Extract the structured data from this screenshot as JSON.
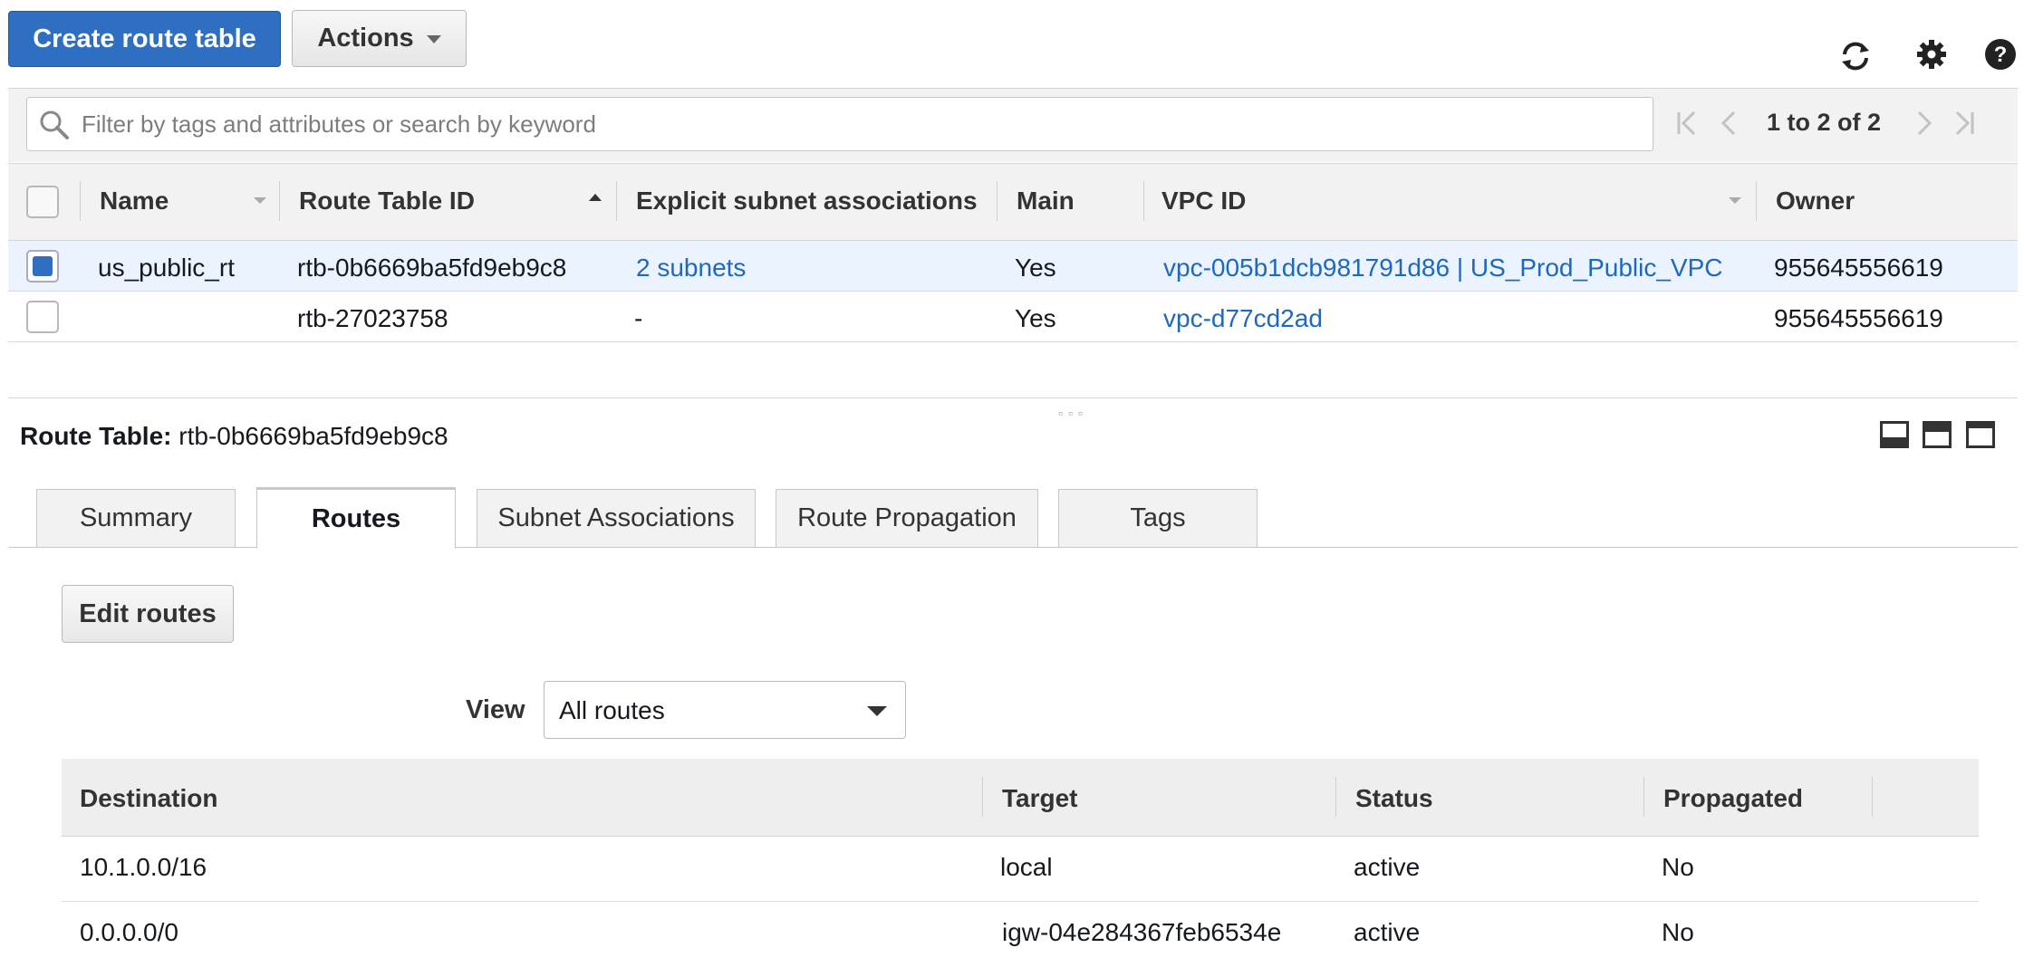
{
  "toolbar": {
    "create_label": "Create route table",
    "actions_label": "Actions"
  },
  "icons": {
    "refresh": "refresh-icon",
    "settings": "gear-icon",
    "help": "help-icon"
  },
  "colors": {
    "primary": "#2f6fc1",
    "link": "#1e68bf",
    "selected_row": "#eaf3fe"
  },
  "filter": {
    "placeholder": "Filter by tags and attributes or search by keyword",
    "value": ""
  },
  "pagination": {
    "text": "1 to 2 of 2"
  },
  "table": {
    "columns": [
      "Name",
      "Route Table ID",
      "Explicit subnet associations",
      "Main",
      "VPC ID",
      "Owner"
    ],
    "rows": [
      {
        "selected": true,
        "name": "us_public_rt",
        "route_table_id": "rtb-0b6669ba5fd9eb9c8",
        "subnets": "2 subnets",
        "main": "Yes",
        "vpc_id": "vpc-005b1dcb981791d86 | US_Prod_Public_VPC",
        "owner": "955645556619"
      },
      {
        "selected": false,
        "name": "",
        "route_table_id": "rtb-27023758",
        "subnets": "-",
        "main": "Yes",
        "vpc_id": "vpc-d77cd2ad",
        "owner": "955645556619"
      }
    ]
  },
  "detail": {
    "label": "Route Table:",
    "value": "rtb-0b6669ba5fd9eb9c8",
    "tabs": [
      "Summary",
      "Routes",
      "Subnet Associations",
      "Route Propagation",
      "Tags"
    ],
    "active_tab": "Routes",
    "edit_label": "Edit routes",
    "view_label": "View",
    "view_selected": "All routes",
    "routes_columns": [
      "Destination",
      "Target",
      "Status",
      "Propagated"
    ],
    "routes": [
      {
        "destination": "10.1.0.0/16",
        "target": "local",
        "status": "active",
        "propagated": "No"
      },
      {
        "destination": "0.0.0.0/0",
        "target": "igw-04e284367feb6534e",
        "status": "active",
        "propagated": "No"
      }
    ]
  }
}
